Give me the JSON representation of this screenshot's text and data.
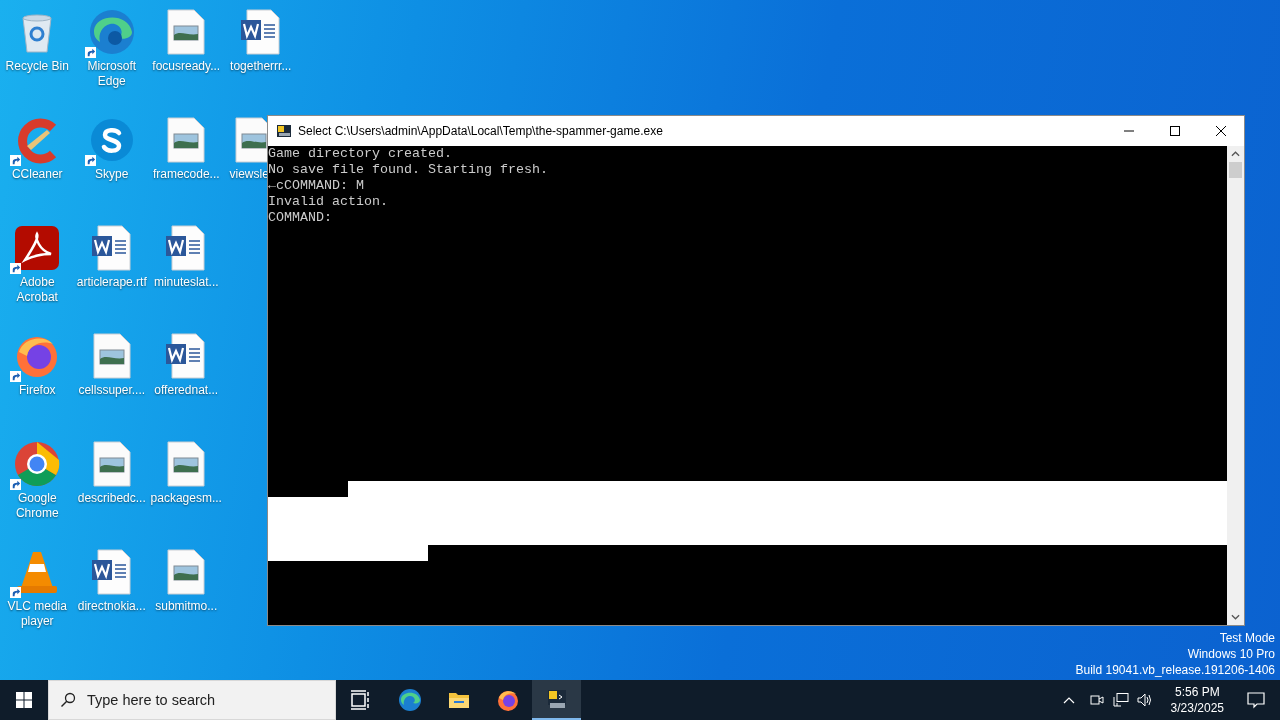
{
  "desktop_icons": [
    {
      "label": "Recycle Bin",
      "kind": "recycle",
      "shortcut": false
    },
    {
      "label": "CCleaner",
      "kind": "ccleaner",
      "shortcut": true
    },
    {
      "label": "Adobe Acrobat",
      "kind": "pdf",
      "shortcut": true
    },
    {
      "label": "Firefox",
      "kind": "firefox",
      "shortcut": true
    },
    {
      "label": "Google Chrome",
      "kind": "chrome",
      "shortcut": true
    },
    {
      "label": "VLC media player",
      "kind": "vlc",
      "shortcut": true
    },
    {
      "label": "Microsoft Edge",
      "kind": "edge",
      "shortcut": true
    },
    {
      "label": "Skype",
      "kind": "skype",
      "shortcut": true
    },
    {
      "label": "articlerape.rtf",
      "kind": "word",
      "shortcut": false
    },
    {
      "label": "cellssuper....",
      "kind": "image",
      "shortcut": false
    },
    {
      "label": "describedc...",
      "kind": "image",
      "shortcut": false
    },
    {
      "label": "directnokia...",
      "kind": "word",
      "shortcut": false
    },
    {
      "label": "focusready...",
      "kind": "image",
      "shortcut": false
    },
    {
      "label": "framecode...",
      "kind": "image",
      "shortcut": false
    },
    {
      "label": "minuteslat...",
      "kind": "word",
      "shortcut": false
    },
    {
      "label": "offerednat...",
      "kind": "word",
      "shortcut": false
    },
    {
      "label": "packagesm...",
      "kind": "image",
      "shortcut": false
    },
    {
      "label": "submitmo...",
      "kind": "image",
      "shortcut": false
    },
    {
      "label": "togetherrr...",
      "kind": "word",
      "shortcut": false
    },
    {
      "label": "viewsle",
      "kind": "image",
      "shortcut": false
    }
  ],
  "console": {
    "title": "Select C:\\Users\\admin\\AppData\\Local\\Temp\\the-spammer-game.exe",
    "lines": [
      "Game directory created.",
      "No save file found. Starting fresh.",
      "←cCOMMAND: M",
      "Invalid action.",
      "COMMAND:"
    ]
  },
  "system_notice": [
    "Test Mode",
    "Windows 10 Pro",
    "Build 19041.vb_release.191206-1406"
  ],
  "taskbar": {
    "search_placeholder": "Type here to search",
    "apps": [
      {
        "kind": "taskview",
        "selected": false
      },
      {
        "kind": "edge",
        "selected": false
      },
      {
        "kind": "explorer",
        "selected": false
      },
      {
        "kind": "firefox",
        "selected": false
      },
      {
        "kind": "console",
        "selected": true
      }
    ],
    "clock": {
      "time": "5:56 PM",
      "date": "3/23/2025"
    }
  }
}
